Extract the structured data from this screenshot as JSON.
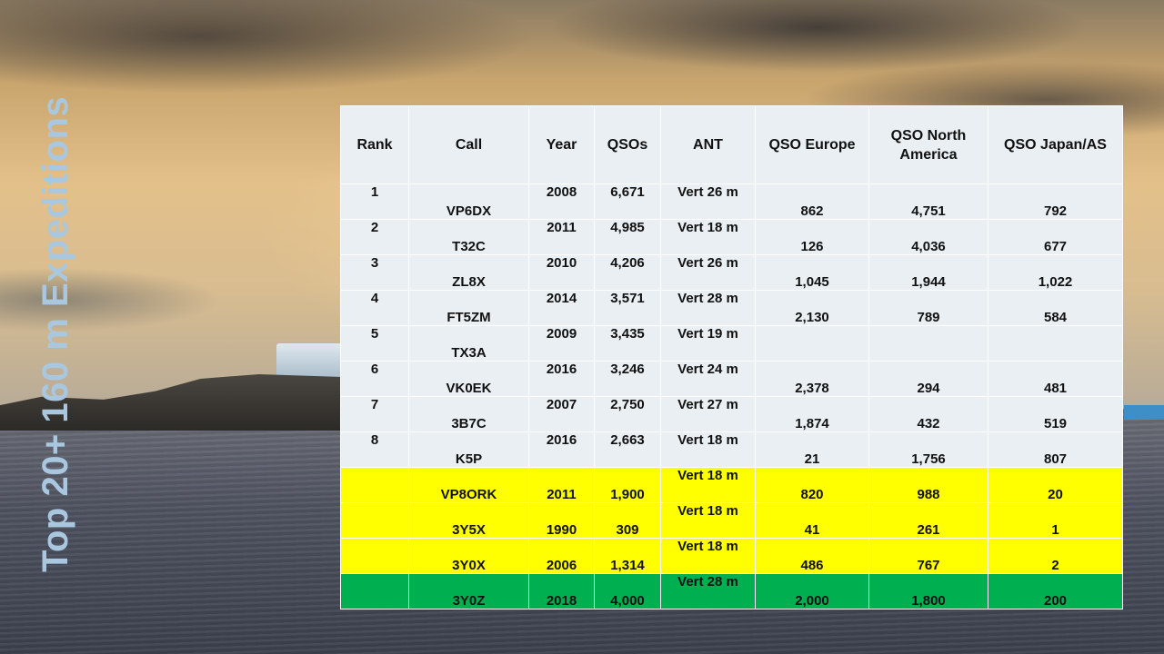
{
  "title": "Top 20+ 160 m Expeditions",
  "table": {
    "headers": [
      "Rank",
      "Call",
      "Year",
      "QSOs",
      "ANT",
      "QSO Europe",
      "QSO North America",
      "QSO Japan/AS"
    ],
    "rows": [
      {
        "rank": "1",
        "call": "VP6DX",
        "year": "2008",
        "qsos": "6,671",
        "ant": "Vert 26 m",
        "eu": "862",
        "na": "4,751",
        "as": "792",
        "highlight": "none"
      },
      {
        "rank": "2",
        "call": "T32C",
        "year": "2011",
        "qsos": "4,985",
        "ant": "Vert 18 m",
        "eu": "126",
        "na": "4,036",
        "as": "677",
        "highlight": "none"
      },
      {
        "rank": "3",
        "call": "ZL8X",
        "year": "2010",
        "qsos": "4,206",
        "ant": "Vert 26 m",
        "eu": "1,045",
        "na": "1,944",
        "as": "1,022",
        "highlight": "none"
      },
      {
        "rank": "4",
        "call": "FT5ZM",
        "year": "2014",
        "qsos": "3,571",
        "ant": "Vert 28 m",
        "eu": "2,130",
        "na": "789",
        "as": "584",
        "highlight": "none"
      },
      {
        "rank": "5",
        "call": "TX3A",
        "year": "2009",
        "qsos": "3,435",
        "ant": "Vert 19 m",
        "eu": "",
        "na": "",
        "as": "",
        "highlight": "none"
      },
      {
        "rank": "6",
        "call": "VK0EK",
        "year": "2016",
        "qsos": "3,246",
        "ant": "Vert 24 m",
        "eu": "2,378",
        "na": "294",
        "as": "481",
        "highlight": "none"
      },
      {
        "rank": "7",
        "call": "3B7C",
        "year": "2007",
        "qsos": "2,750",
        "ant": "Vert 27 m",
        "eu": "1,874",
        "na": "432",
        "as": "519",
        "highlight": "none"
      },
      {
        "rank": "8",
        "call": "K5P",
        "year": "2016",
        "qsos": "2,663",
        "ant": "Vert 18 m",
        "eu": "21",
        "na": "1,756",
        "as": "807",
        "highlight": "none"
      },
      {
        "rank": "",
        "call": "VP8ORK",
        "year": "2011",
        "qsos": "1,900",
        "ant": "Vert 18 m",
        "eu": "820",
        "na": "988",
        "as": "20",
        "highlight": "yellow"
      },
      {
        "rank": "",
        "call": "3Y5X",
        "year": "1990",
        "qsos": "309",
        "ant": "Vert 18 m",
        "eu": "41",
        "na": "261",
        "as": "1",
        "highlight": "yellow"
      },
      {
        "rank": "",
        "call": "3Y0X",
        "year": "2006",
        "qsos": "1,314",
        "ant": "Vert 18 m",
        "eu": "486",
        "na": "767",
        "as": "2",
        "highlight": "yellow"
      },
      {
        "rank": "",
        "call": "3Y0Z",
        "year": "2018",
        "qsos": "4,000",
        "ant": "Vert 28 m",
        "eu": "2,000",
        "na": "1,800",
        "as": "200",
        "highlight": "green"
      }
    ]
  },
  "colors": {
    "table_bg": "#e9eff3",
    "highlight_yellow": "#ffff00",
    "highlight_green": "#00b050",
    "title_color": "#a9c7df"
  }
}
